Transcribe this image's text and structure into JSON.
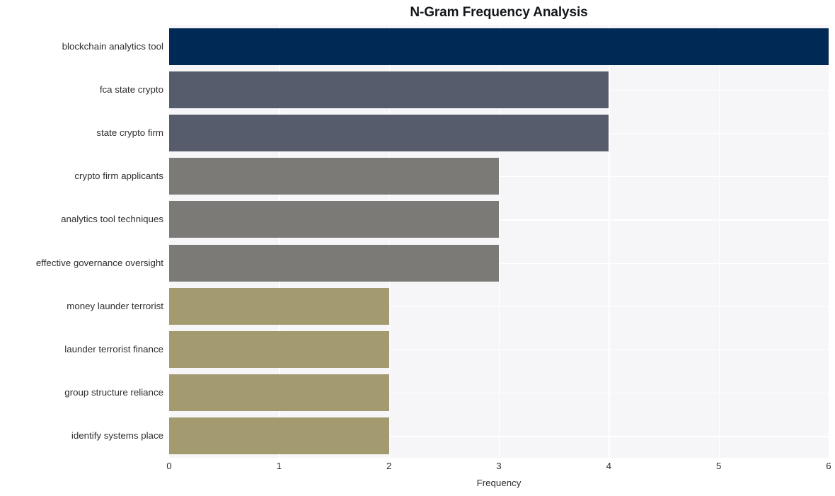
{
  "chart_data": {
    "type": "bar",
    "orientation": "horizontal",
    "title": "N-Gram Frequency Analysis",
    "xlabel": "Frequency",
    "ylabel": "",
    "categories": [
      "blockchain analytics tool",
      "fca state crypto",
      "state crypto firm",
      "crypto firm applicants",
      "analytics tool techniques",
      "effective governance oversight",
      "money launder terrorist",
      "launder terrorist finance",
      "group structure reliance",
      "identify systems place"
    ],
    "values": [
      6,
      4,
      4,
      3,
      3,
      3,
      2,
      2,
      2,
      2
    ],
    "bar_colors": [
      "#002a55",
      "#565c6b",
      "#565c6b",
      "#7b7a76",
      "#7b7a76",
      "#7b7a76",
      "#a39a70",
      "#a39a70",
      "#a39a70",
      "#a39a70"
    ],
    "xlim": [
      0,
      6
    ],
    "xticks": [
      0,
      1,
      2,
      3,
      4,
      5,
      6
    ],
    "xticklabels": [
      "0",
      "1",
      "2",
      "3",
      "4",
      "5",
      "6"
    ],
    "grid": true,
    "grid_color": "#ffffff",
    "plot_background": "#f6f6f8",
    "figure_background": "#ffffff",
    "legend": null,
    "legend_position": "none"
  }
}
